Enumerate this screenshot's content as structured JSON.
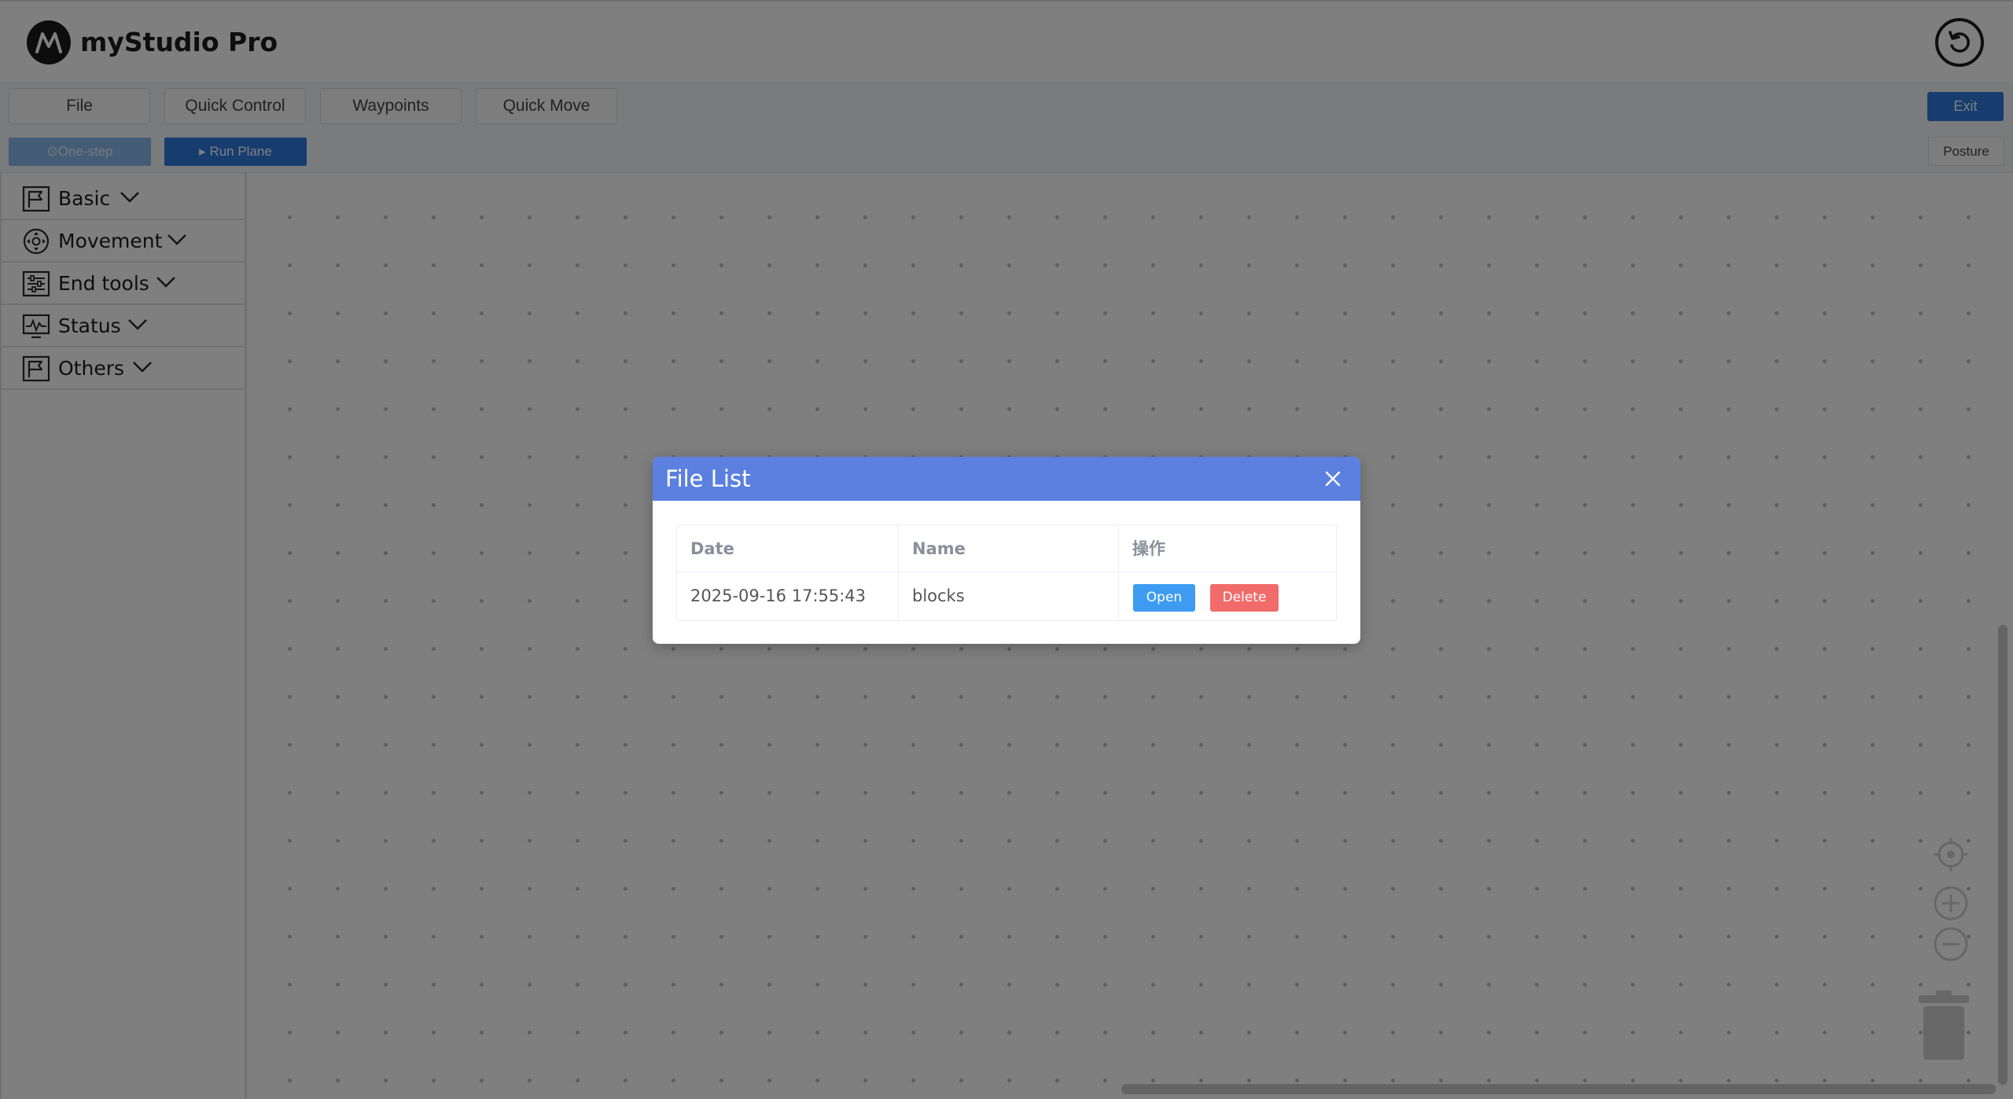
{
  "header": {
    "app_title": "myStudio Pro"
  },
  "toolbar": {
    "file_label": "File",
    "quick_control_label": "Quick Control",
    "waypoints_label": "Waypoints",
    "quick_move_label": "Quick Move",
    "exit_label": "Exit",
    "one_step_label": "One-step",
    "run_plane_label": "Run Plane",
    "posture_label": "Posture"
  },
  "sidebar": {
    "items": [
      {
        "label": "Basic",
        "icon": "flag-icon"
      },
      {
        "label": "Movement",
        "icon": "move-icon"
      },
      {
        "label": "End tools",
        "icon": "sliders-icon"
      },
      {
        "label": "Status",
        "icon": "monitor-icon"
      },
      {
        "label": "Others",
        "icon": "flag-icon"
      }
    ]
  },
  "modal": {
    "title": "File List",
    "columns": [
      "Date",
      "Name",
      "操作"
    ],
    "rows": [
      {
        "date": "2025-09-16 17:55:43",
        "name": "blocks",
        "open_label": "Open",
        "delete_label": "Delete"
      }
    ]
  },
  "colors": {
    "primary": "#2f7bde",
    "modal_header": "#5b80e0",
    "open": "#3d9cf2",
    "delete": "#f26b6b"
  }
}
